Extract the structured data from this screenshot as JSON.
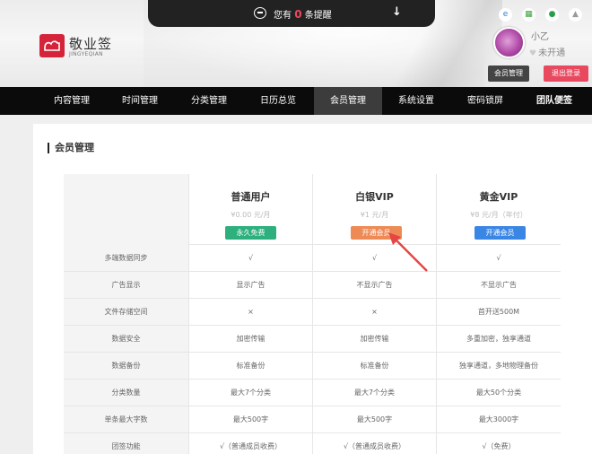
{
  "notice": {
    "prefix": "您有",
    "count": "0",
    "suffix": "条提醒"
  },
  "logo": {
    "name": "敬业签",
    "sub": "JINGYEQIAN"
  },
  "apps": [
    {
      "icon": "ie-icon",
      "glyph": "e",
      "color": "#2a7fd4"
    },
    {
      "icon": "windows-icon",
      "glyph": "▦",
      "color": "#3aa13a"
    },
    {
      "icon": "apple-icon",
      "glyph": "●",
      "color": "#2a9d4a"
    },
    {
      "icon": "android-icon",
      "glyph": "▲",
      "color": "#9a9a9a"
    }
  ],
  "user": {
    "name": "小乙",
    "status": "未开通",
    "member_btn": "会员管理",
    "logout_btn": "退出登录"
  },
  "nav": [
    "内容管理",
    "时间管理",
    "分类管理",
    "日历总览",
    "会员管理",
    "系统设置",
    "密码锁屏",
    "团队便签"
  ],
  "section_title": "会员管理",
  "plans": [
    {
      "name": "普通用户",
      "price": "¥0.00 元/月",
      "button": "永久免费"
    },
    {
      "name": "白银VIP",
      "price": "¥1 元/月",
      "button": "开通会员"
    },
    {
      "name": "黄金VIP",
      "price": "¥8 元/月（年付）",
      "button": "开通会员"
    }
  ],
  "rows": [
    [
      "多端数据同步",
      "√",
      "√",
      "√"
    ],
    [
      "广告显示",
      "显示广告",
      "不显示广告",
      "不显示广告"
    ],
    [
      "文件存储空间",
      "×",
      "×",
      "首开送500M"
    ],
    [
      "数据安全",
      "加密传输",
      "加密传输",
      "多重加密，独享通道"
    ],
    [
      "数据备份",
      "标准备份",
      "标准备份",
      "独享通道，多地物理备份"
    ],
    [
      "分类数量",
      "最大7个分类",
      "最大7个分类",
      "最大50个分类"
    ],
    [
      "单条最大字数",
      "最大500字",
      "最大500字",
      "最大3000字"
    ],
    [
      "团签功能",
      "√（普通成员收费）",
      "√（普通成员收费）",
      "√（免费）"
    ]
  ],
  "colors": {
    "nav_bg": "#0b0b0b",
    "brand_red": "#d5243a",
    "free_green": "#2db07e",
    "silver_orange": "#ee8a55",
    "gold_blue": "#3a86e4",
    "annotation": "#e64545"
  }
}
